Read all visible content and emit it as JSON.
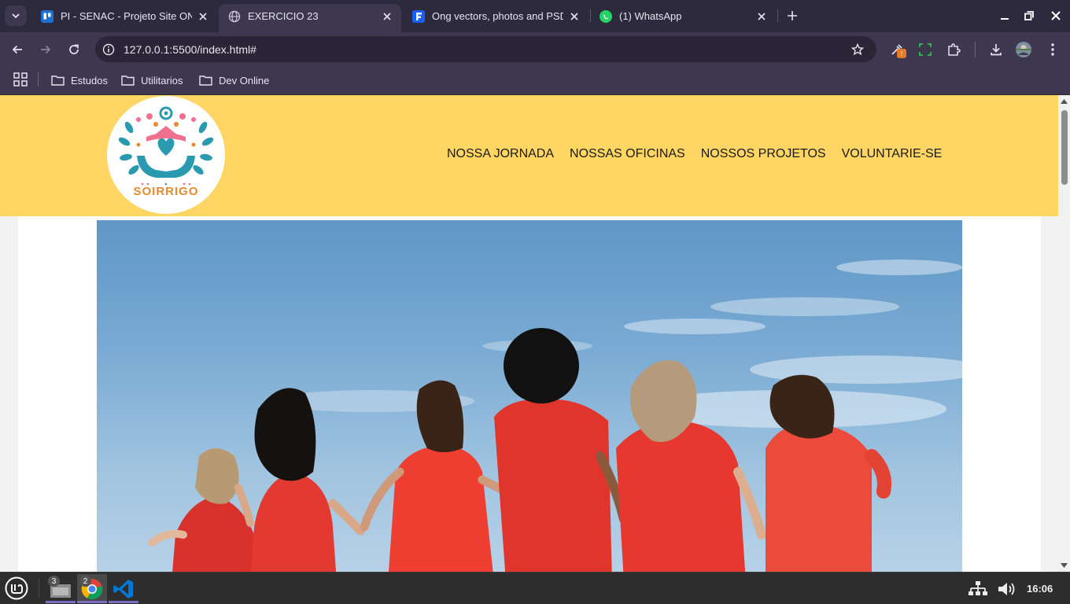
{
  "browser": {
    "tabs": [
      {
        "title": "PI - SENAC - Projeto Site ONG",
        "icon": "trello-icon",
        "active": false
      },
      {
        "title": "EXERCICIO 23",
        "icon": "globe-icon",
        "active": true
      },
      {
        "title": "Ong vectors, photos and PSD",
        "icon": "freepik-icon",
        "active": false
      },
      {
        "title": "(1) WhatsApp",
        "icon": "whatsapp-icon",
        "active": false
      }
    ],
    "url": "127.0.0.1:5500/index.html#",
    "bookmarks": [
      {
        "label": "Estudos",
        "icon": "folder-icon"
      },
      {
        "label": "Utilitarios",
        "icon": "folder-icon"
      },
      {
        "label": "Dev Online",
        "icon": "folder-icon"
      }
    ],
    "extension_badge": "!"
  },
  "site": {
    "logo_text": "SOIRRIGO",
    "nav": [
      {
        "label": "NOSSA JORNADA"
      },
      {
        "label": "NOSSAS OFICINAS"
      },
      {
        "label": "NOSSOS PROJETOS"
      },
      {
        "label": "VOLUNTARIE-SE"
      }
    ],
    "hero_alt": "Women in red dresses holding hands under a blue sky"
  },
  "taskbar": {
    "apps": [
      {
        "name": "files",
        "count": "3"
      },
      {
        "name": "chrome",
        "count": "2"
      },
      {
        "name": "vscode",
        "count": ""
      }
    ],
    "clock": "16:06"
  },
  "colors": {
    "header_bg": "#ffd663",
    "browser_chrome": "#3d3850",
    "logo_teal": "#2a9ab0",
    "logo_pink": "#f0708f",
    "logo_orange": "#e58a2f"
  }
}
